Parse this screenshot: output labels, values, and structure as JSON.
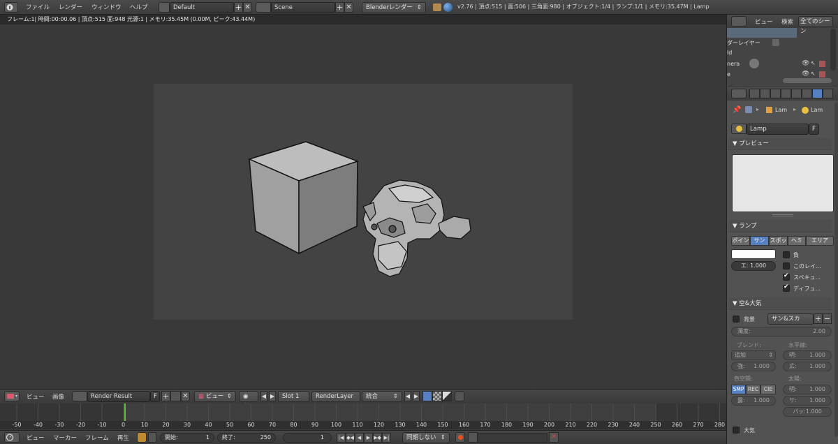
{
  "topbar": {
    "menus": [
      "ファイル",
      "レンダー",
      "ウィンドウ",
      "ヘルプ"
    ],
    "layout": "Default",
    "scene": "Scene",
    "engine": "Blenderレンダー",
    "stats": "v2.76 | 頂点:515 | 面:506 | 三角面:980 | オブジェクト:1/4 | ランプ:1/1 | メモリ:35.47M | Lamp"
  },
  "render_info": "フレーム:1| 時間:00:00.06 | 頂点:515 面:948 光源:1 | メモリ:35.45M (0.00M, ピーク:43.44M)",
  "image_editor": {
    "view": "ビュー",
    "image": "画像",
    "image_name": "Render Result",
    "fake_user": "F",
    "view_select": "ビュー",
    "slot": "Slot 1",
    "layer": "RenderLayer",
    "pass": "統合"
  },
  "timeline": {
    "ticks": [
      "-50",
      "-40",
      "-30",
      "-20",
      "-10",
      "0",
      "10",
      "20",
      "30",
      "40",
      "50",
      "60",
      "70",
      "80",
      "90",
      "100",
      "110",
      "120",
      "130",
      "140",
      "150",
      "160",
      "170",
      "180",
      "190",
      "200",
      "210",
      "220",
      "230",
      "240",
      "250",
      "260",
      "270",
      "280"
    ],
    "current_frame_value": 0,
    "menus": [
      "ビュー",
      "マーカー",
      "フレーム",
      "再生"
    ],
    "start_label": "開始:",
    "start_value": "1",
    "end_label": "終了:",
    "end_value": "250",
    "current": "1",
    "sync": "同期しない"
  },
  "outliner": {
    "view": "ビュー",
    "search": "検索",
    "all_scenes": "全てのシーン",
    "rows": [
      "ダーレイヤー",
      "ld",
      "nera",
      "e"
    ]
  },
  "properties": {
    "breadcrumb_a": "Lam",
    "breadcrumb_b": "Lam",
    "datablock": "Lamp",
    "fake": "F",
    "preview_title": "▼ プレビュー",
    "lamp_title": "▼ ランプ",
    "lamp_types": [
      "ポイン",
      "サン",
      "スポッ",
      "ヘミ",
      "エリア"
    ],
    "lamp_type_active": 1,
    "negative": "負",
    "this_layer": "このレイ...",
    "specular": "スペキュ...",
    "diffuse": "ディフュ...",
    "energy": "エ:  1.000",
    "sky_title": "▼ 空&大気",
    "sky_bg": "背景",
    "sky_preset": "サン&スカ",
    "turbidity": "濁度:",
    "turbidity_value": "2.00",
    "blend_label": "ブレンド:",
    "horizon_label": "水平線:",
    "blend_mode": "追加",
    "bright_label": "明:",
    "bright_value": "1.000",
    "strength_label": "強:",
    "strength_value": "1.000",
    "spread_label": "広:",
    "spread_value": "1.000",
    "colorspace_label": "色空間:",
    "sun_label": "太陽:",
    "colorspaces": [
      "SMP",
      "REC",
      "CIE"
    ],
    "exposure_label": "露:",
    "exposure_value": "1.000",
    "sun_bright_label": "明:",
    "sun_bright_value": "1.000",
    "sun_size_label": "サ:",
    "sun_size_value": "1.000",
    "backscatter": "バッ:1.000",
    "atmosphere": "大気"
  }
}
